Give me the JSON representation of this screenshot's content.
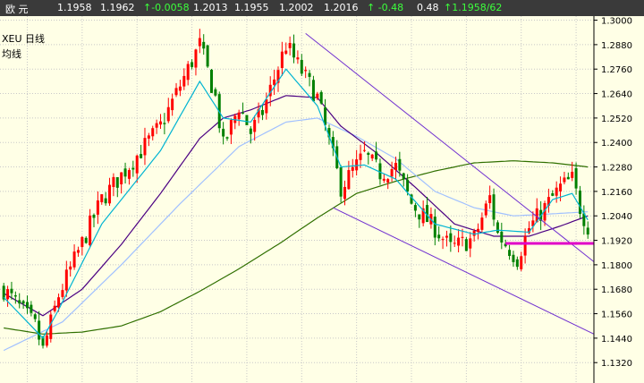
{
  "quote_bar": {
    "name": "欧 元",
    "last": "1.1958",
    "ask": "1.1962",
    "change": "↑-0.0058",
    "high": "1.2013",
    "low": "1.1955",
    "open": "1.2002",
    "prev_close": "1.2016",
    "change_pct": "↑ -0.48",
    "amplitude": "0.48",
    "last_size": "↑1.1958/62"
  },
  "chart_header": {
    "symbol_line": "XEU  日线",
    "indicator_line": "均线"
  },
  "colors": {
    "background": "#ffffe6",
    "quote_bar": "#3a3a3a",
    "up_candle": "#ff0000",
    "down_candle": "#008000",
    "ma_fast": "#00b4d2",
    "ma_mid": "#4b0082",
    "ma_slow": "#a0c0ff",
    "ma_long": "#2f6f00",
    "channel": "#7030d0",
    "support": "#e000c8",
    "grid": "#c8c8c8"
  },
  "chart_data": {
    "type": "candlestick",
    "y_axis_labels": [
      "1.3000",
      "1.2880",
      "1.2760",
      "1.2640",
      "1.2520",
      "1.2400",
      "1.2280",
      "1.2160",
      "1.2040",
      "1.1920",
      "1.1800",
      "1.1680",
      "1.1560",
      "1.1440",
      "1.1320"
    ],
    "ylim": [
      1.122,
      1.302
    ],
    "grid": true,
    "n_bars": 150,
    "price_path": [
      [
        0,
        1.168
      ],
      [
        8,
        1.15
      ],
      [
        10,
        1.138
      ],
      [
        14,
        1.165
      ],
      [
        25,
        1.212
      ],
      [
        40,
        1.248
      ],
      [
        50,
        1.288
      ],
      [
        54,
        1.262
      ],
      [
        56,
        1.238
      ],
      [
        60,
        1.258
      ],
      [
        63,
        1.245
      ],
      [
        66,
        1.255
      ],
      [
        72,
        1.288
      ],
      [
        75,
        1.278
      ],
      [
        80,
        1.262
      ],
      [
        86,
        1.218
      ],
      [
        92,
        1.234
      ],
      [
        96,
        1.225
      ],
      [
        100,
        1.228
      ],
      [
        104,
        1.21
      ],
      [
        110,
        1.198
      ],
      [
        114,
        1.188
      ],
      [
        120,
        1.193
      ],
      [
        124,
        1.213
      ],
      [
        126,
        1.195
      ],
      [
        131,
        1.183
      ],
      [
        134,
        1.198
      ],
      [
        138,
        1.208
      ],
      [
        142,
        1.218
      ],
      [
        145,
        1.222
      ],
      [
        147,
        1.208
      ],
      [
        149,
        1.199
      ]
    ],
    "moving_averages": [
      {
        "name": "MA fast",
        "points": [
          [
            0,
            1.164
          ],
          [
            10,
            1.144
          ],
          [
            14,
            1.158
          ],
          [
            25,
            1.2
          ],
          [
            40,
            1.236
          ],
          [
            50,
            1.27
          ],
          [
            56,
            1.252
          ],
          [
            63,
            1.25
          ],
          [
            72,
            1.276
          ],
          [
            80,
            1.258
          ],
          [
            86,
            1.228
          ],
          [
            92,
            1.229
          ],
          [
            100,
            1.222
          ],
          [
            110,
            1.2
          ],
          [
            120,
            1.195
          ],
          [
            126,
            1.197
          ],
          [
            134,
            1.196
          ],
          [
            140,
            1.212
          ],
          [
            145,
            1.215
          ],
          [
            149,
            1.202
          ]
        ]
      },
      {
        "name": "MA mid",
        "points": [
          [
            0,
            1.166
          ],
          [
            10,
            1.155
          ],
          [
            20,
            1.168
          ],
          [
            30,
            1.19
          ],
          [
            40,
            1.215
          ],
          [
            50,
            1.242
          ],
          [
            56,
            1.252
          ],
          [
            63,
            1.256
          ],
          [
            72,
            1.263
          ],
          [
            80,
            1.262
          ],
          [
            86,
            1.248
          ],
          [
            95,
            1.235
          ],
          [
            105,
            1.218
          ],
          [
            115,
            1.2
          ],
          [
            125,
            1.194
          ],
          [
            134,
            1.194
          ],
          [
            142,
            1.199
          ],
          [
            149,
            1.204
          ]
        ]
      },
      {
        "name": "MA slow",
        "points": [
          [
            0,
            1.138
          ],
          [
            15,
            1.152
          ],
          [
            30,
            1.18
          ],
          [
            45,
            1.21
          ],
          [
            60,
            1.238
          ],
          [
            72,
            1.25
          ],
          [
            80,
            1.252
          ],
          [
            90,
            1.243
          ],
          [
            100,
            1.232
          ],
          [
            110,
            1.216
          ],
          [
            120,
            1.208
          ],
          [
            130,
            1.204
          ],
          [
            140,
            1.205
          ],
          [
            149,
            1.206
          ]
        ]
      },
      {
        "name": "MA long",
        "points": [
          [
            0,
            1.149
          ],
          [
            10,
            1.146
          ],
          [
            20,
            1.147
          ],
          [
            30,
            1.15
          ],
          [
            40,
            1.157
          ],
          [
            50,
            1.167
          ],
          [
            60,
            1.178
          ],
          [
            70,
            1.19
          ],
          [
            80,
            1.203
          ],
          [
            90,
            1.215
          ],
          [
            100,
            1.221
          ],
          [
            110,
            1.226
          ],
          [
            120,
            1.23
          ],
          [
            130,
            1.231
          ],
          [
            140,
            1.23
          ],
          [
            149,
            1.228
          ]
        ]
      }
    ],
    "trendlines": [
      {
        "name": "channel upper",
        "from": [
          77,
          1.2935
        ],
        "to": [
          160,
          1.1815
        ]
      },
      {
        "name": "channel lower",
        "from": [
          84,
          1.208
        ],
        "to": [
          160,
          1.146
        ]
      },
      {
        "name": "support",
        "from": [
          128,
          1.1905
        ],
        "to": [
          160,
          1.1905
        ]
      }
    ]
  }
}
